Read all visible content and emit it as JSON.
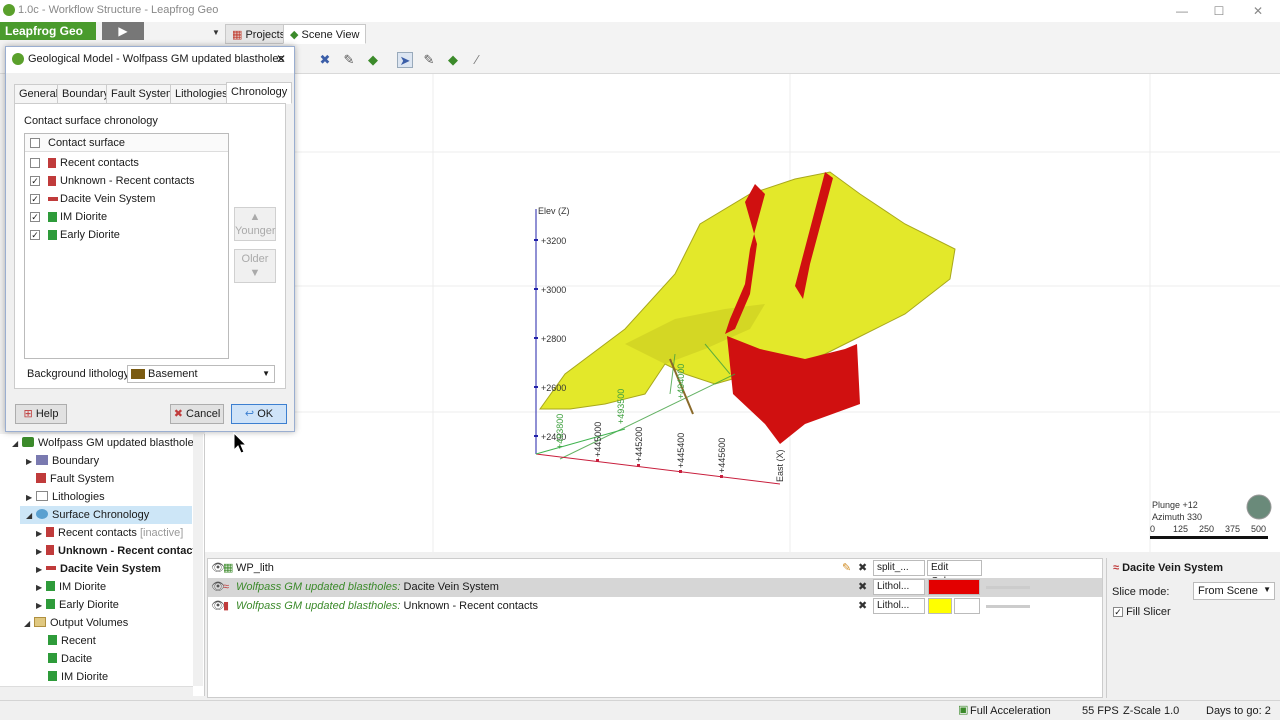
{
  "window": {
    "title": "1.0c - Workflow Structure - Leapfrog Geo",
    "minimize": "—",
    "maximize": "☐",
    "close": "✕"
  },
  "toolbar": {
    "brand": "Leapfrog Geo",
    "play": "▶",
    "tabs": [
      {
        "label": "Projects"
      },
      {
        "label": "Scene View"
      }
    ]
  },
  "dialog": {
    "title": "Geological Model - Wolfpass GM updated blastholes",
    "close": "✕",
    "tabs": [
      "General",
      "Boundary",
      "Fault System",
      "Lithologies",
      "Chronology"
    ],
    "section_label": "Contact surface chronology",
    "list_header": "Contact surface",
    "items": [
      {
        "label": "Recent contacts",
        "checked": false,
        "color": "#c03b3b"
      },
      {
        "label": "Unknown - Recent contacts",
        "checked": true,
        "color": "#c03b3b"
      },
      {
        "label": "Dacite Vein System",
        "checked": true,
        "color": "#c03b3b"
      },
      {
        "label": "IM Diorite",
        "checked": true,
        "color": "#2e9b3a"
      },
      {
        "label": "Early Diorite",
        "checked": true,
        "color": "#2e9b3a"
      }
    ],
    "younger": "Younger",
    "older": "Older",
    "background_label": "Background lithology:",
    "background_value": "Basement",
    "help": "Help",
    "cancel": "Cancel",
    "ok": "OK"
  },
  "tree": {
    "items": [
      {
        "label": "Wolfpass GM updated blastholes"
      },
      {
        "label": "Boundary"
      },
      {
        "label": "Fault System"
      },
      {
        "label": "Lithologies"
      },
      {
        "label": "Surface Chronology"
      },
      {
        "label": "Recent contacts",
        "note": "[inactive]"
      },
      {
        "label": "Unknown - Recent contacts"
      },
      {
        "label": "Dacite Vein System"
      },
      {
        "label": "IM Diorite"
      },
      {
        "label": "Early Diorite"
      },
      {
        "label": "Output Volumes"
      },
      {
        "label": "Recent"
      },
      {
        "label": "Dacite"
      },
      {
        "label": "IM Diorite"
      }
    ]
  },
  "scene": {
    "axis_z_label": "Elev (Z)",
    "z_ticks": [
      "+3200",
      "+3000",
      "+2800",
      "+2600",
      "+2400"
    ],
    "x_label": "East (X)",
    "x_ticks": [
      "+445000",
      "+445200",
      "+445400",
      "+445600"
    ],
    "y_ticks": [
      "+493800",
      "+493500",
      "+494000"
    ],
    "plunge": "Plunge +12",
    "azimuth": "Azimuth 330",
    "scale_ticks": [
      "0",
      "125",
      "250",
      "375",
      "500"
    ]
  },
  "shapes": {
    "rows": [
      {
        "prefix": "",
        "name": "WP_lith",
        "ctl1": "split_...",
        "ctl2": "Edit Colours"
      },
      {
        "prefix": "Wolfpass GM updated blastholes:",
        "name": "Dacite Vein System",
        "ctl1": "Lithol...",
        "color": "#e30000"
      },
      {
        "prefix": "Wolfpass GM updated blastholes:",
        "name": "Unknown - Recent contacts",
        "ctl1": "Lithol...",
        "color": "#ffff00"
      }
    ]
  },
  "props": {
    "title": "Dacite Vein System",
    "slice_mode_label": "Slice mode:",
    "slice_mode_value": "From Scene",
    "fill_slicer": "Fill Slicer"
  },
  "status": {
    "accel": "Full Acceleration",
    "fps": "55 FPS",
    "zscale": "Z-Scale 1.0",
    "days": "Days to go: 2"
  },
  "colors": {
    "brand": "#4a9b2d",
    "surface_yellow": "#e6e62e",
    "surface_red": "#d01010"
  }
}
